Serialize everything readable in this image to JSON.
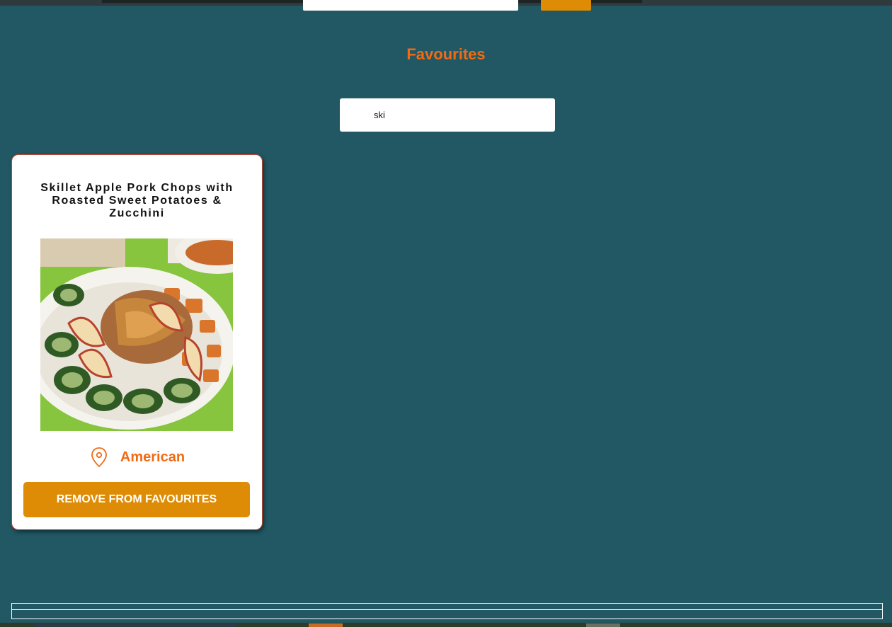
{
  "header": {
    "title": "Favourites"
  },
  "search": {
    "value": "ski"
  },
  "favourites": [
    {
      "title": "Skillet Apple Pork Chops with Roasted Sweet Potatoes & Zucchini",
      "area": "American",
      "image_icon": "recipe-photo",
      "location_icon": "map-pin-icon",
      "remove_label": "REMOVE FROM FAVOURITES"
    }
  ],
  "colors": {
    "background": "#215864",
    "accent_orange": "#f06b14",
    "button": "#de8c05",
    "card_border": "#c4452b"
  }
}
